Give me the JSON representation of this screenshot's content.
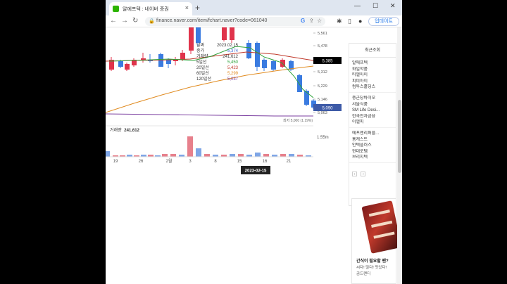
{
  "browser": {
    "tab_title": "알에프텍 : 네이버 증권",
    "url": "finance.naver.com/item/fchart.naver?code=061040",
    "update_label": "업데이트",
    "new_tab": "+",
    "min": "—",
    "max": "☐",
    "close": "✕",
    "back": "←",
    "forward": "→",
    "reload": "↻",
    "lock": "🔒",
    "google": "G",
    "share": "⇪",
    "star": "☆",
    "ext": "✱",
    "split": "▯",
    "avatar": "●",
    "menu": "⋮",
    "tab_close": "×"
  },
  "tooltip": {
    "rows": [
      {
        "label": "날짜",
        "value": "2023.02.15",
        "color": "#333333"
      },
      {
        "label": "종가",
        "value": "5,374",
        "color": "#3c6fd6"
      },
      {
        "label": "거래량",
        "value": "241,612",
        "color": "#333333"
      },
      {
        "label": "5일선",
        "value": "5,450",
        "color": "#2fa33c"
      },
      {
        "label": "20일선",
        "value": "5,423",
        "color": "#c0392b"
      },
      {
        "label": "60일선",
        "value": "5,299",
        "color": "#e08a1e"
      },
      {
        "label": "120일선",
        "value": "5,037",
        "color": "#7b3fa0"
      }
    ]
  },
  "chart_data": {
    "type": "candlestick",
    "price_axis": [
      "5,561",
      "5,478",
      "5,395",
      "5,312",
      "5,229",
      "5,146",
      "5,063"
    ],
    "current_price": "5,385",
    "low_price_tag": "5,090",
    "low_label": "최저 5,000 (1.19%)",
    "volume_title": "거래량",
    "volume_value": "241,612",
    "volume_axis": "1.55m",
    "x_ticks": [
      "19",
      "26",
      "2월",
      "3",
      "8",
      "15",
      "16",
      "21"
    ],
    "crosshair_date": "2023-02-15",
    "colors": {
      "up": "#e0334b",
      "down": "#3a7be0",
      "ma5": "#2fa33c",
      "ma20": "#c0392b",
      "ma60": "#e08a1e",
      "ma120": "#7b3fa0"
    }
  },
  "sidebar": {
    "header": "최근조회",
    "groups": [
      [
        "알에프텍",
        "화일약품",
        "티엘아이",
        "피피아이",
        "컴투스홀딩스"
      ],
      [
        "중근당바이오",
        "서울식품",
        "SM Life Desi...",
        "한국전자금융",
        "이엘피"
      ],
      [
        "에프엔리퍼블...",
        "홈캐스트",
        "인텍플러스",
        "현대로템",
        "브리지텍"
      ]
    ],
    "pager": [
      "‹",
      "›"
    ]
  },
  "ad": {
    "line1": "간식이 필요할 땐?",
    "line2": "씨다! 많다! 맛있다!",
    "line3": "곰드랜디"
  }
}
